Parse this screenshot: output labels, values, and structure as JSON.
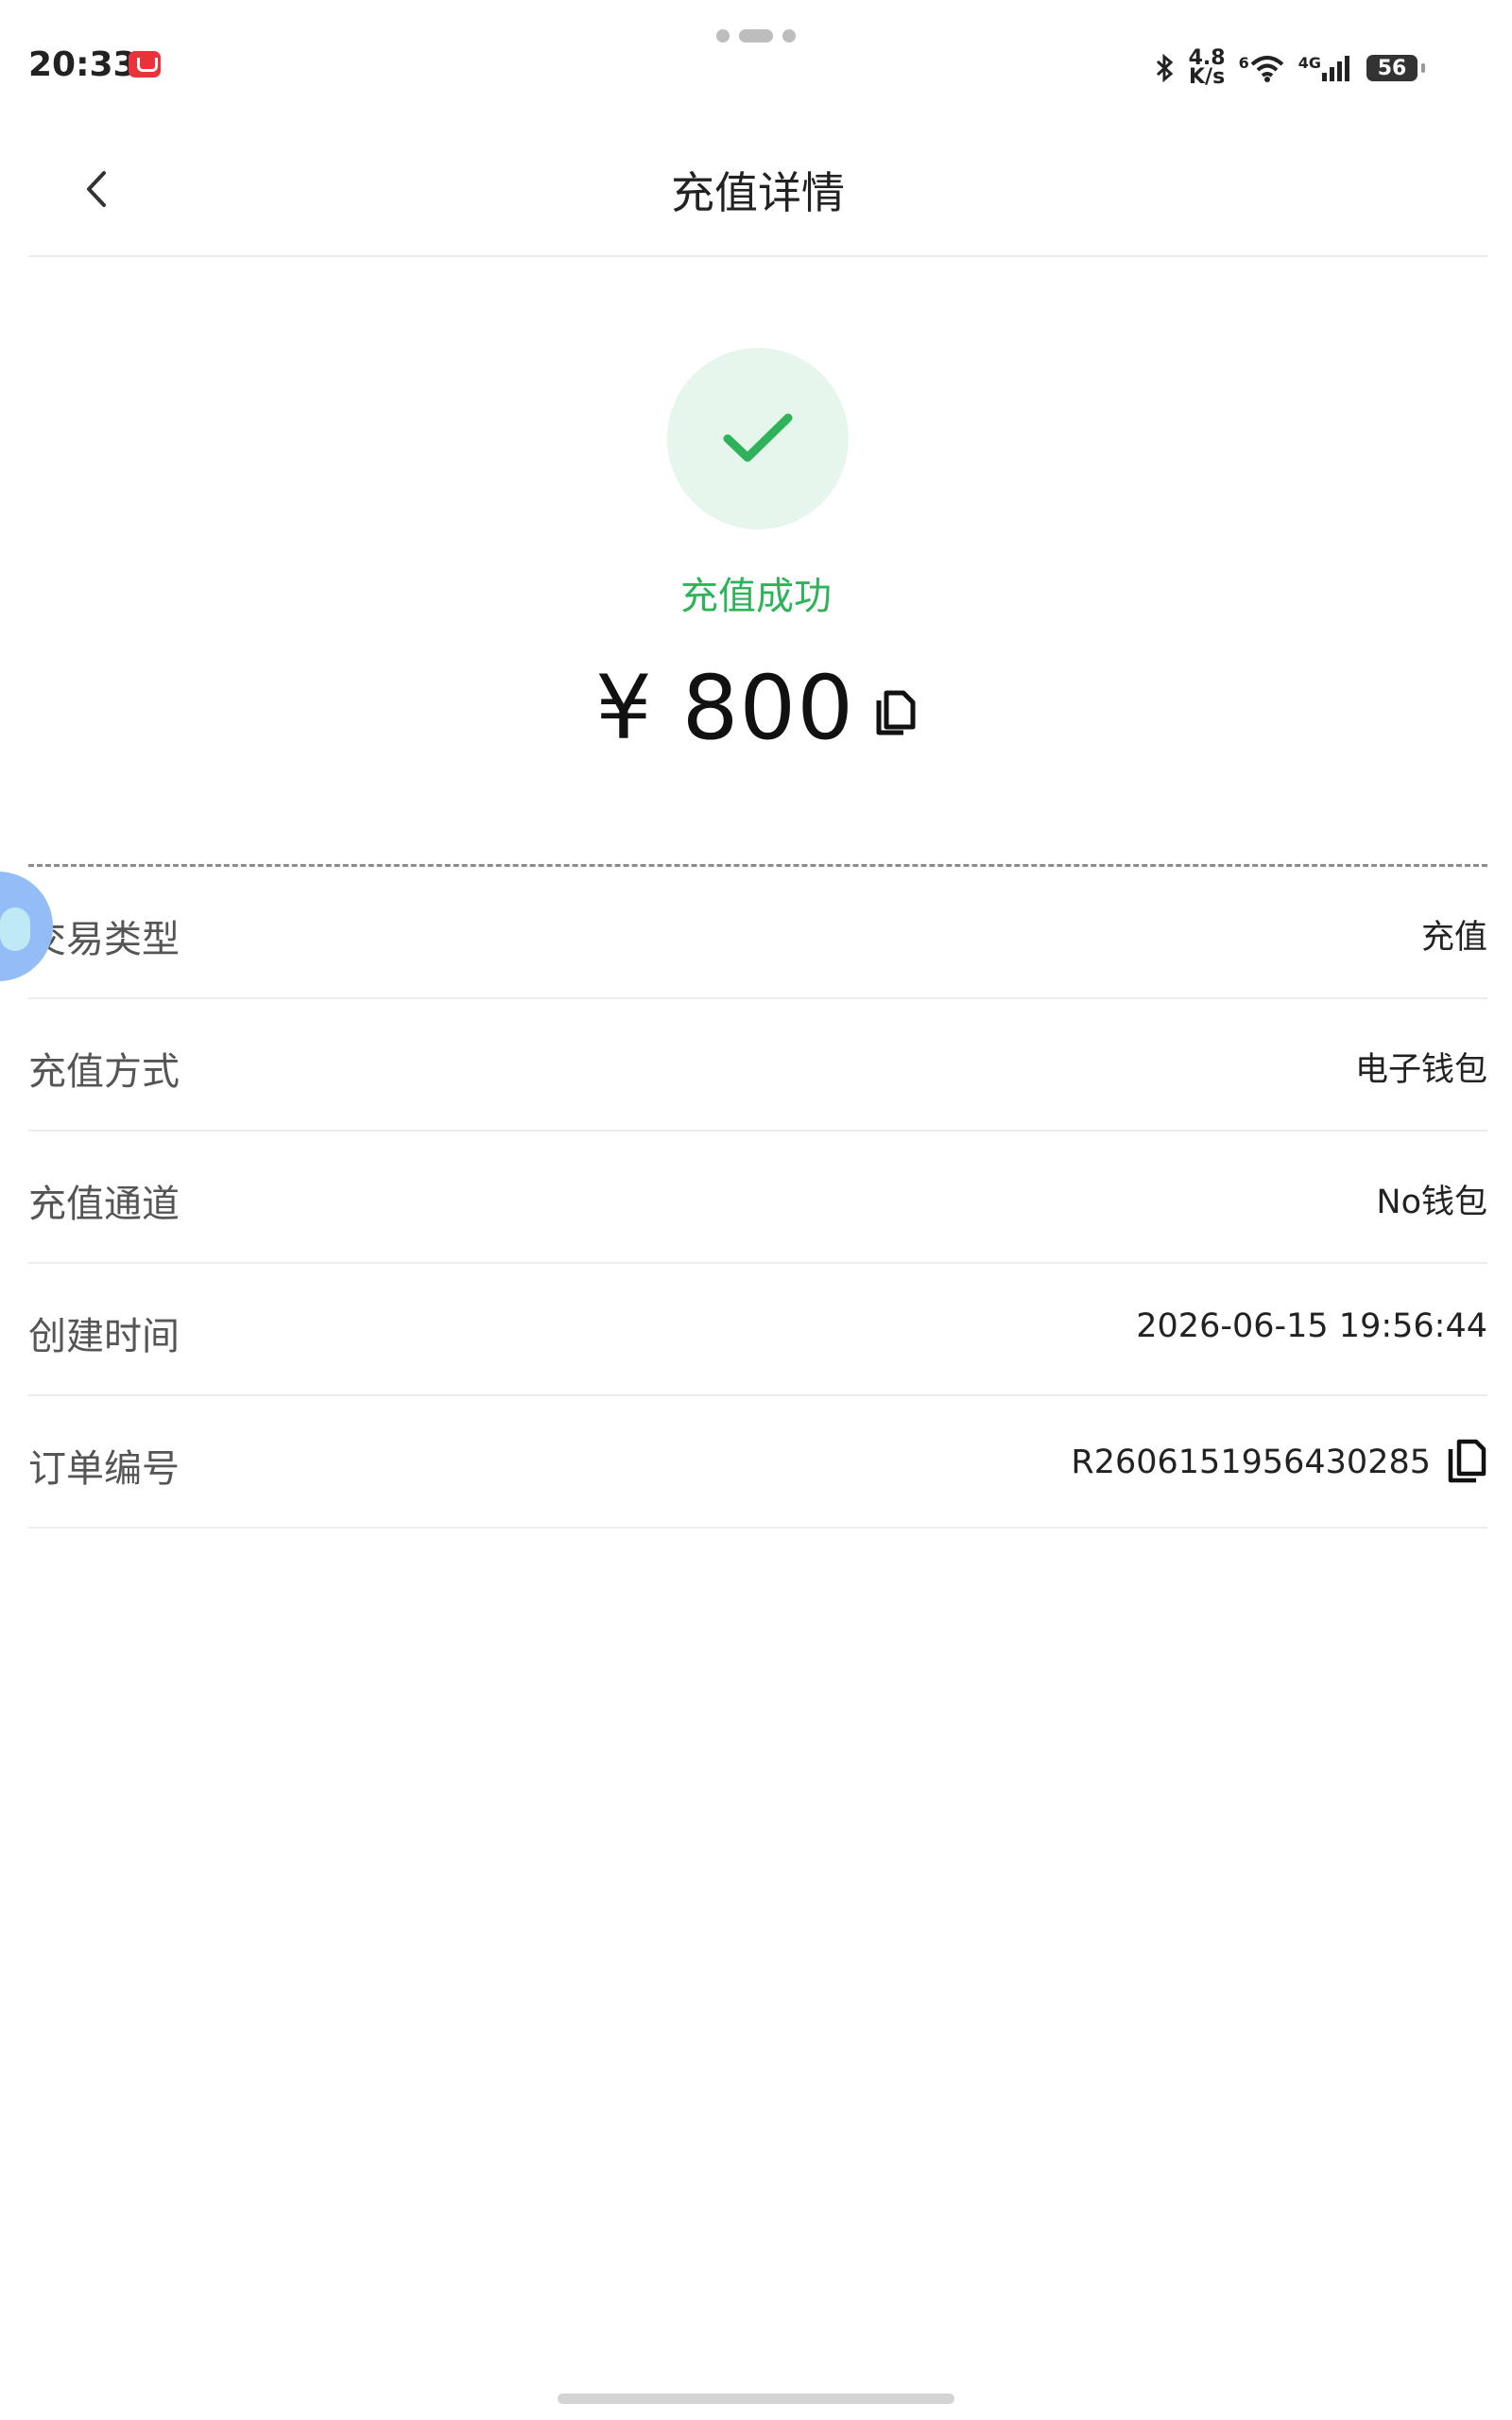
{
  "status_bar": {
    "time": "20:33",
    "net_speed_top": "4.8",
    "net_speed_bottom": "K/s",
    "wifi_tag": "6",
    "cell_tag": "4G",
    "battery": "56",
    "icons": [
      "notification-app-icon",
      "bluetooth-icon",
      "wifi-icon",
      "cell-signal-icon",
      "battery-icon"
    ]
  },
  "header": {
    "title": "充值详情",
    "back_icon": "chevron-left-icon"
  },
  "result": {
    "status": "充值成功",
    "amount": "¥ 800",
    "status_color": "#2fb25a",
    "icon": "check-icon",
    "copy_icon": "copy-icon"
  },
  "details": [
    {
      "label": "交易类型",
      "value": "充值"
    },
    {
      "label": "充值方式",
      "value": "电子钱包"
    },
    {
      "label": "充值通道",
      "value": "No钱包"
    },
    {
      "label": "创建时间",
      "value": "2026-06-15 19:56:44"
    },
    {
      "label": "订单编号",
      "value": "R2606151956430285"
    }
  ]
}
